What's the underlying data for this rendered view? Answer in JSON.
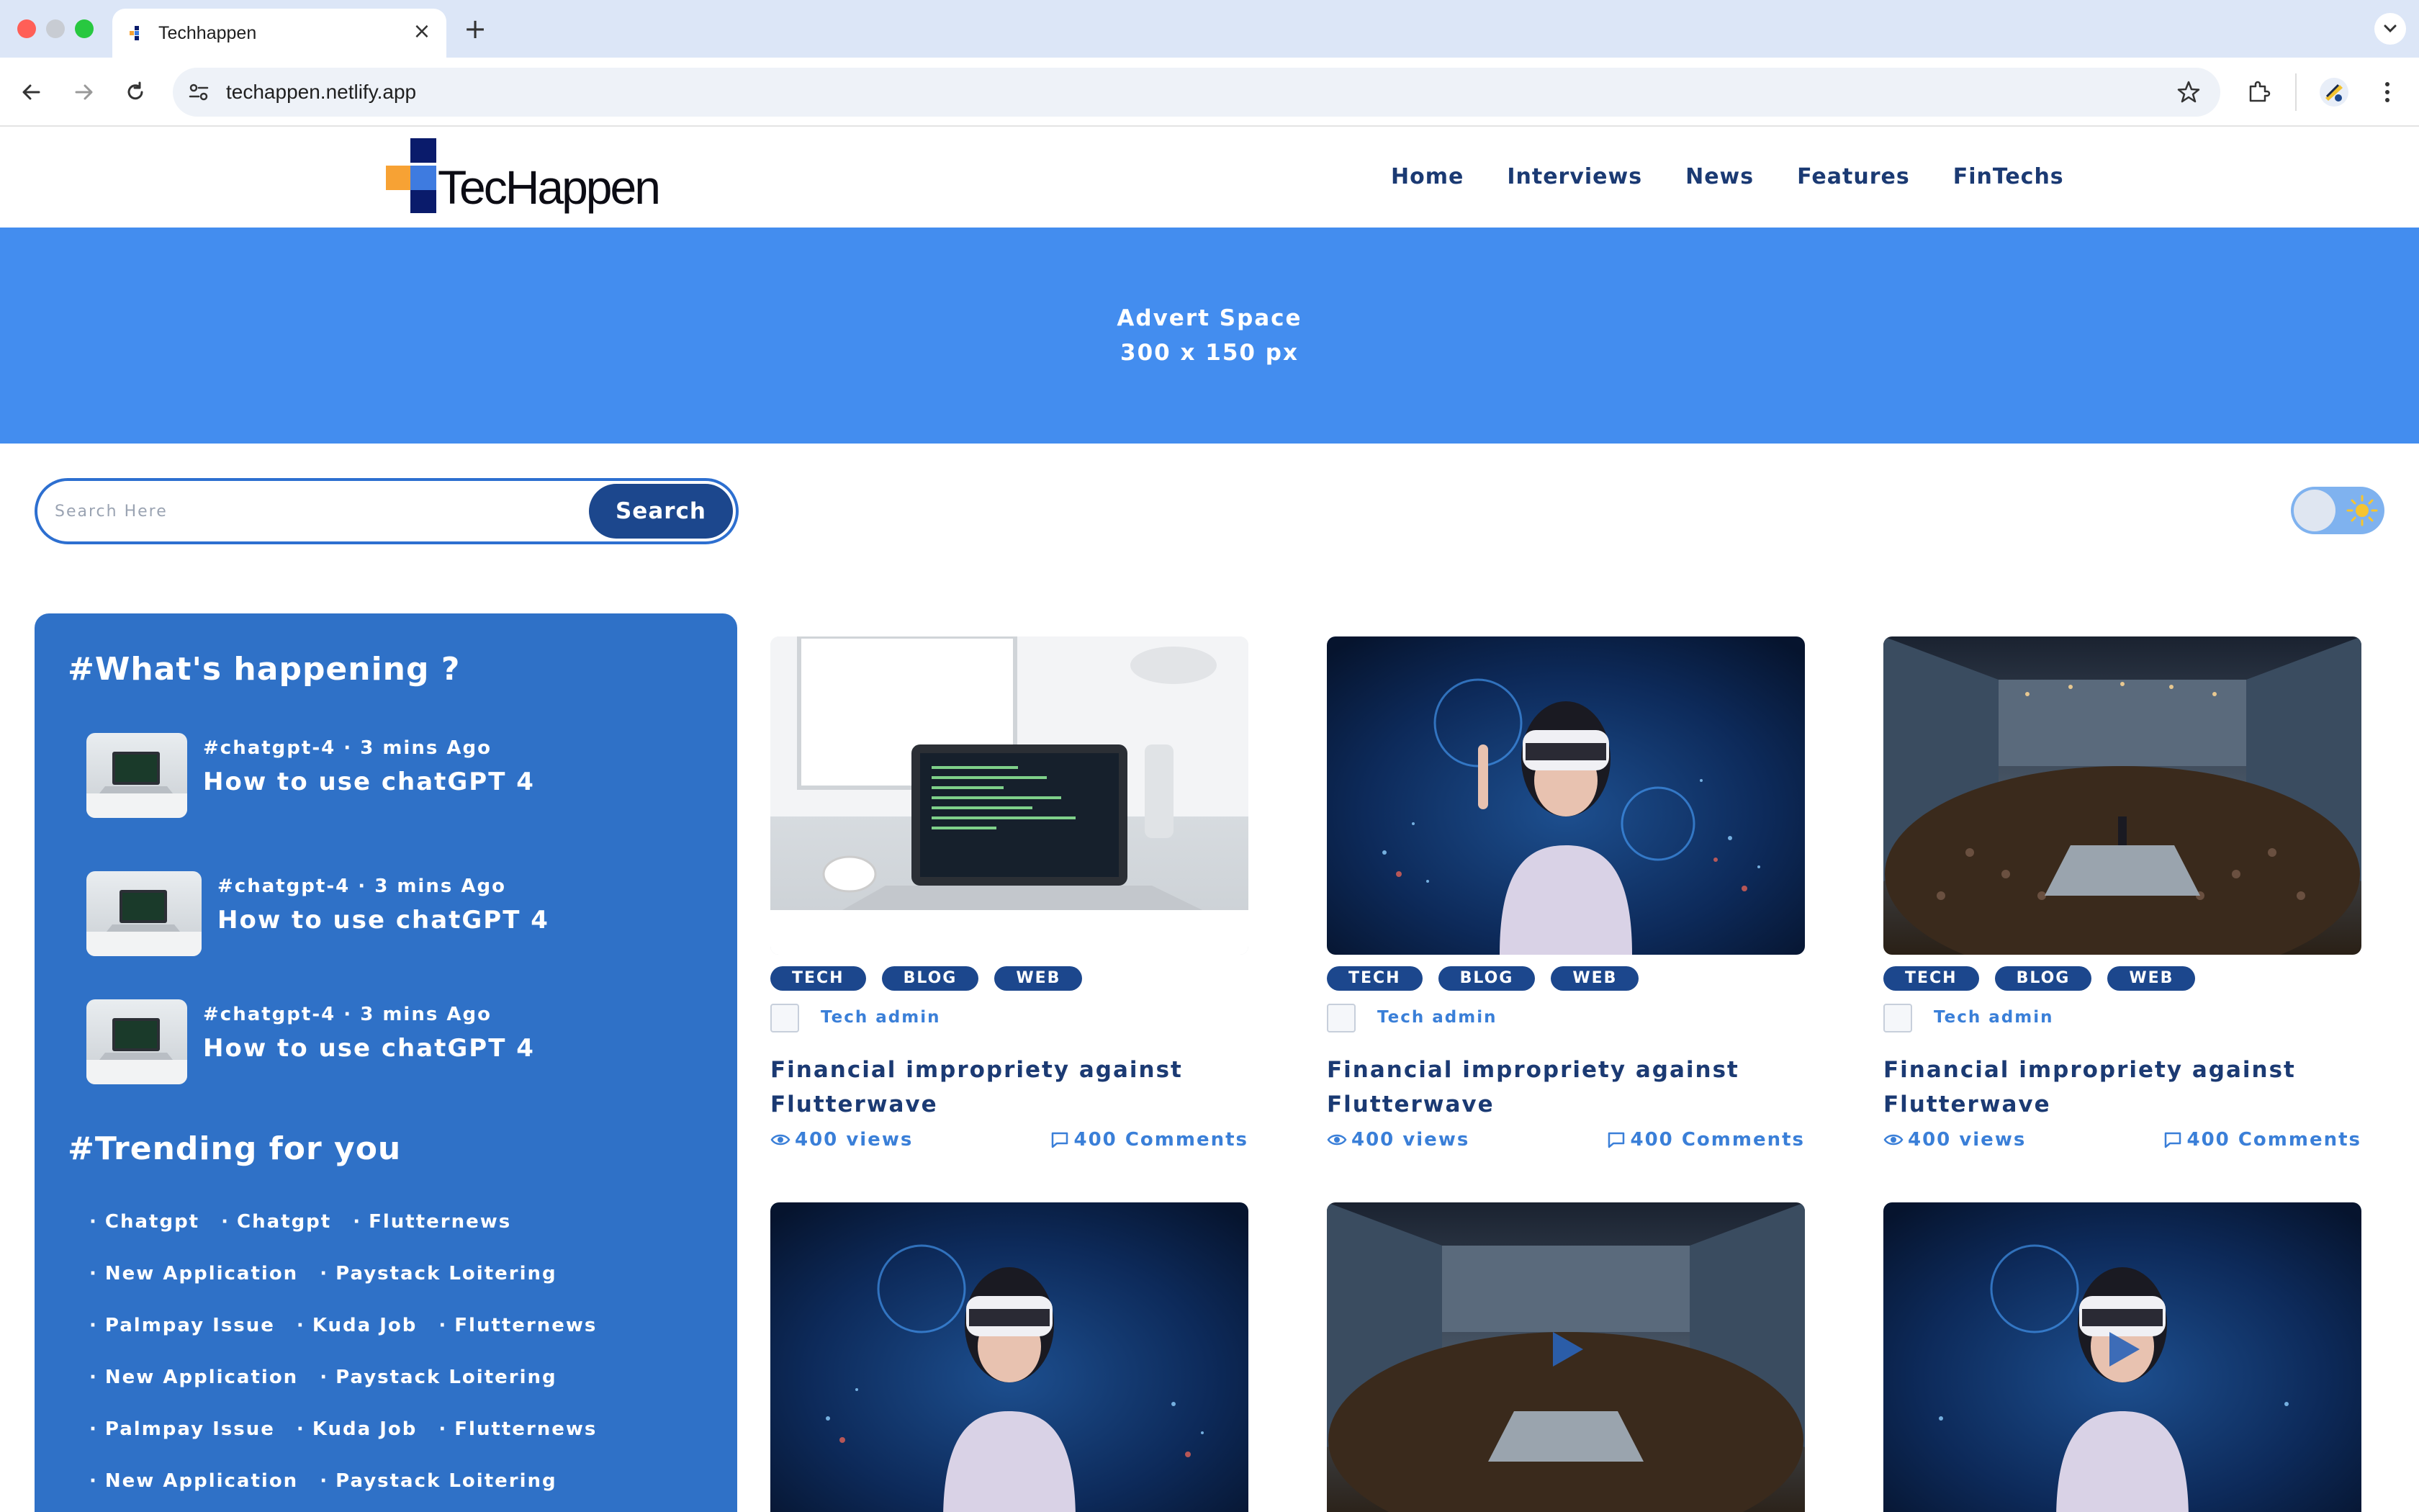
{
  "browser": {
    "tab_title": "Techhappen",
    "url": "techappen.netlify.app",
    "colors": {
      "tabbar": "#dce6f7",
      "omnibox": "#eef2f8"
    }
  },
  "site": {
    "logo_text": "TecHappen",
    "nav": [
      "Home",
      "Interviews",
      "News",
      "Features",
      "FinTechs"
    ],
    "colors": {
      "primary": "#1c478d",
      "accent": "#438def",
      "sidebar": "#2f71c7",
      "link": "#3a7fd8"
    }
  },
  "advert": {
    "line1": "Advert Space",
    "line2": "300 x 150 px"
  },
  "search": {
    "placeholder": "Search Here",
    "value": "",
    "button_label": "Search"
  },
  "theme_toggle": {
    "state": "light",
    "icon": "sun-icon"
  },
  "sidebar": {
    "whats_happening_title": "#What's happening ?",
    "items": [
      {
        "meta": "#chatgpt-4 · 3 mins Ago",
        "title": "How to use chatGPT 4"
      },
      {
        "meta": "#chatgpt-4 · 3 mins Ago",
        "title": "How to use chatGPT 4"
      },
      {
        "meta": "#chatgpt-4 · 3 mins Ago",
        "title": "How to use chatGPT 4"
      }
    ],
    "trending_title": "#Trending for you",
    "trending_rows": [
      [
        "Chatgpt",
        "Chatgpt",
        "Flutternews"
      ],
      [
        "New Application",
        "Paystack Loitering"
      ],
      [
        "Palmpay Issue",
        "Kuda Job",
        "Flutternews"
      ],
      [
        "New Application",
        "Paystack Loitering"
      ],
      [
        "Palmpay Issue",
        "Kuda Job",
        "Flutternews"
      ],
      [
        "New Application",
        "Paystack Loitering"
      ]
    ]
  },
  "cards": [
    {
      "image": "laptop-desk",
      "tags": [
        "TECH",
        "BLOG",
        "WEB"
      ],
      "author": "Tech admin",
      "title": "Financial impropriety against Flutterwave",
      "views": "400 views",
      "comments": "400 Comments"
    },
    {
      "image": "vr-headset",
      "tags": [
        "TECH",
        "BLOG",
        "WEB"
      ],
      "author": "Tech admin",
      "title": "Financial impropriety against Flutterwave",
      "views": "400 views",
      "comments": "400 Comments"
    },
    {
      "image": "conference-hall",
      "tags": [
        "TECH",
        "BLOG",
        "WEB"
      ],
      "author": "Tech admin",
      "title": "Financial impropriety against Flutterwave",
      "views": "400 views",
      "comments": "400 Comments"
    },
    {
      "image": "vr-headset"
    },
    {
      "image": "conference-hall",
      "video": true
    },
    {
      "image": "vr-headset",
      "video": true
    }
  ]
}
